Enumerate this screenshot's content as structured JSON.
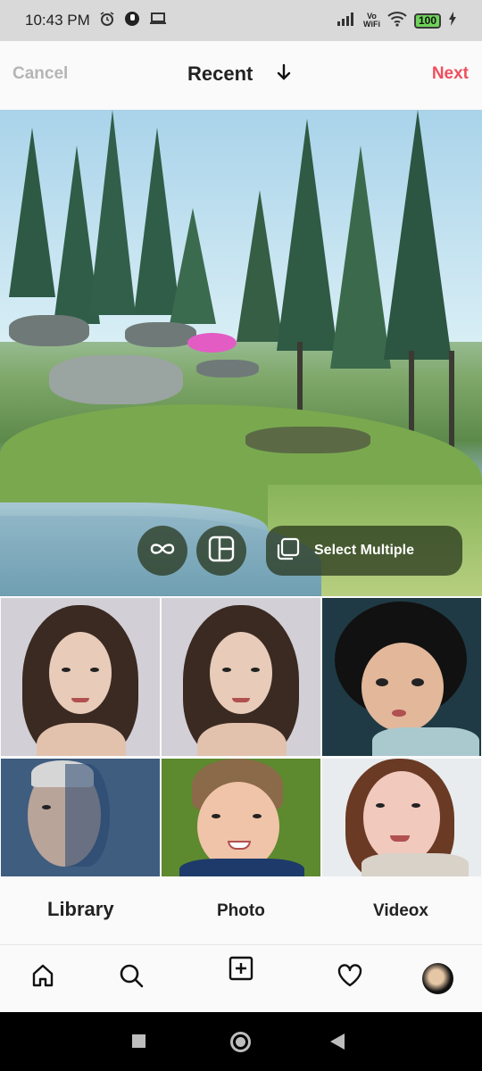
{
  "status_bar": {
    "time": "10:43 PM",
    "network_label": "Vo\nWiFi",
    "battery": "100"
  },
  "header": {
    "cancel_label": "Cancel",
    "title": "Recent",
    "next_label": "Next"
  },
  "preview": {
    "select_multiple_label": "Select Multiple",
    "boomerang_icon": "infinity-icon",
    "layout_icon": "layout-icon",
    "select_multiple_icon": "multi-select-icon"
  },
  "gallery": {
    "thumbnails": [
      {
        "subject": "woman-portrait"
      },
      {
        "subject": "woman-portrait"
      },
      {
        "subject": "child-portrait"
      },
      {
        "subject": "man-portrait"
      },
      {
        "subject": "boy-portrait"
      },
      {
        "subject": "woman-smiling"
      }
    ]
  },
  "source_tabs": [
    {
      "label": "Library"
    },
    {
      "label": "Photo"
    },
    {
      "label": "Videox"
    }
  ],
  "bottom_nav": {
    "items": [
      "home-icon",
      "search-icon",
      "add-post-icon",
      "heart-icon",
      "profile-avatar"
    ]
  },
  "colors": {
    "accent": "#f04e5e",
    "cancel_gray": "#b5b5b5",
    "status_bg": "#d9d9d9"
  }
}
